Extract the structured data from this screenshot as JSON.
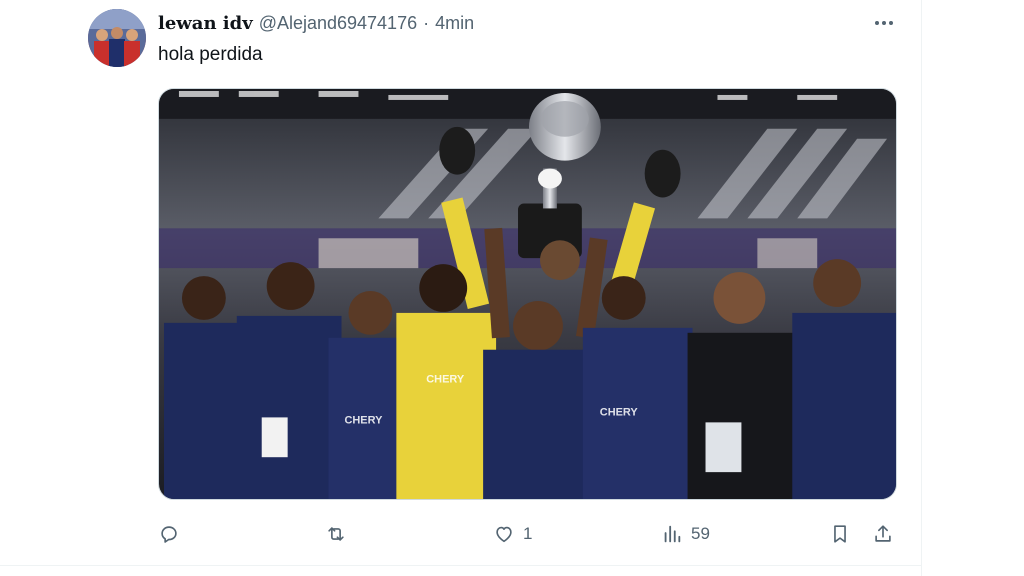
{
  "tweet": {
    "display_name": "lewan idv",
    "handle": "@Alejand69474176",
    "separator": "·",
    "time": "4min",
    "text": "hola perdida"
  },
  "more": {
    "icon": "more-horizontal-icon"
  },
  "actions": {
    "reply": {
      "icon": "reply-icon",
      "count": ""
    },
    "retweet": {
      "icon": "retweet-icon",
      "count": ""
    },
    "like": {
      "icon": "heart-icon",
      "count": "1"
    },
    "views": {
      "icon": "views-bar-chart-icon",
      "count": "59"
    },
    "bookmark": {
      "icon": "bookmark-icon"
    },
    "share": {
      "icon": "share-icon"
    }
  },
  "colors": {
    "text_primary": "#0f1419",
    "text_secondary": "#536471",
    "border": "#eff3f4",
    "jersey_navy": "#1e2a5c",
    "keeper_yellow": "#e8d23a"
  }
}
